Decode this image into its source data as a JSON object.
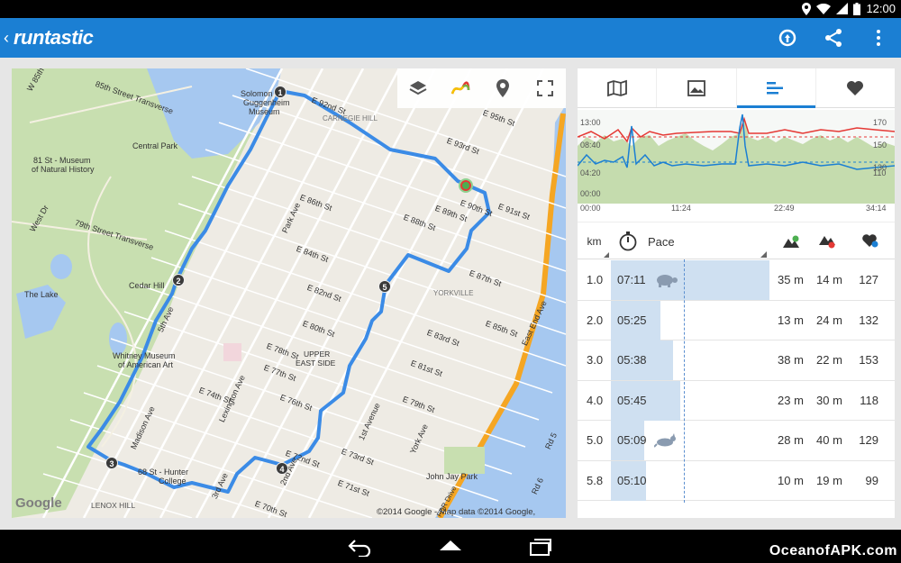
{
  "status": {
    "time": "12:00"
  },
  "app": {
    "logo": "runtastic"
  },
  "map": {
    "copyright": "©2014 Google - Map data ©2014 Google, Sanborn",
    "google": "Google",
    "labels": [
      "Solomon R",
      "Guggenheim",
      "Museum",
      "E 92nd St",
      "CARNEGIE HILL",
      "E 95th St",
      "E 93rd St",
      "W 85th St",
      "85th Street Transverse",
      "Central Park",
      "81 St - Museum",
      "of Natural History",
      "79th Street Transverse",
      "West Dr",
      "The Lake",
      "Cedar Hill",
      "Whitney Museum",
      "of American Art",
      "E 86th St",
      "E 84th St",
      "E 82nd St",
      "E 80th St",
      "E 78th St",
      "E 77th St",
      "E 76th St",
      "E 74th St",
      "UPPER",
      "EAST SIDE",
      "Park Ave",
      "Lexington Ave",
      "Madison Ave",
      "5th Ave",
      "E 88th St",
      "E 89th St",
      "E 90th St",
      "E 91st St",
      "E 87th St",
      "YORKVILLE",
      "E 85th St",
      "E 83rd St",
      "E 81st St",
      "E 79th St",
      "1st Avenue",
      "York Ave",
      "John Jay Park",
      "FDR Drive",
      "68 St - Hunter",
      "College",
      "LENOX HILL",
      "E 70th St",
      "E 72nd St",
      "3rd Ave",
      "2nd Ave",
      "E 71st St",
      "E 73rd St",
      "East End Ave",
      "Rd 5",
      "Rd 6"
    ],
    "markers": [
      "1",
      "2",
      "3",
      "4",
      "5"
    ]
  },
  "graph": {
    "left_labels": [
      "13:00",
      "08:40",
      "04:20",
      "00:00"
    ],
    "right_labels": [
      "170",
      "150",
      "130",
      "110"
    ],
    "x_labels": [
      "00:00",
      "11:24",
      "22:49",
      "34:14"
    ]
  },
  "table": {
    "headers": {
      "km": "km",
      "pace": "Pace"
    },
    "rows": [
      {
        "km": "1.0",
        "pace": "07:11",
        "pace_fraction": 1.0,
        "icon": "turtle-icon",
        "up": "35 m",
        "down": "14 m",
        "hr": "127"
      },
      {
        "km": "2.0",
        "pace": "05:25",
        "pace_fraction": 0.31,
        "icon": "",
        "up": "13 m",
        "down": "24 m",
        "hr": "132"
      },
      {
        "km": "3.0",
        "pace": "05:38",
        "pace_fraction": 0.39,
        "icon": "",
        "up": "38 m",
        "down": "22 m",
        "hr": "153"
      },
      {
        "km": "4.0",
        "pace": "05:45",
        "pace_fraction": 0.44,
        "icon": "",
        "up": "23 m",
        "down": "30 m",
        "hr": "118"
      },
      {
        "km": "5.0",
        "pace": "05:09",
        "pace_fraction": 0.21,
        "icon": "rabbit-icon",
        "up": "28 m",
        "down": "40 m",
        "hr": "129"
      },
      {
        "km": "5.8",
        "pace": "05:10",
        "pace_fraction": 0.22,
        "icon": "",
        "up": "10 m",
        "down": "19 m",
        "hr": "99"
      }
    ]
  },
  "watermark": "OceanofAPK.com",
  "colors": {
    "brand": "#1b7fd3",
    "route": "#3b8be6",
    "bar": "#cfe0f1",
    "hr_line": "#e53935"
  }
}
